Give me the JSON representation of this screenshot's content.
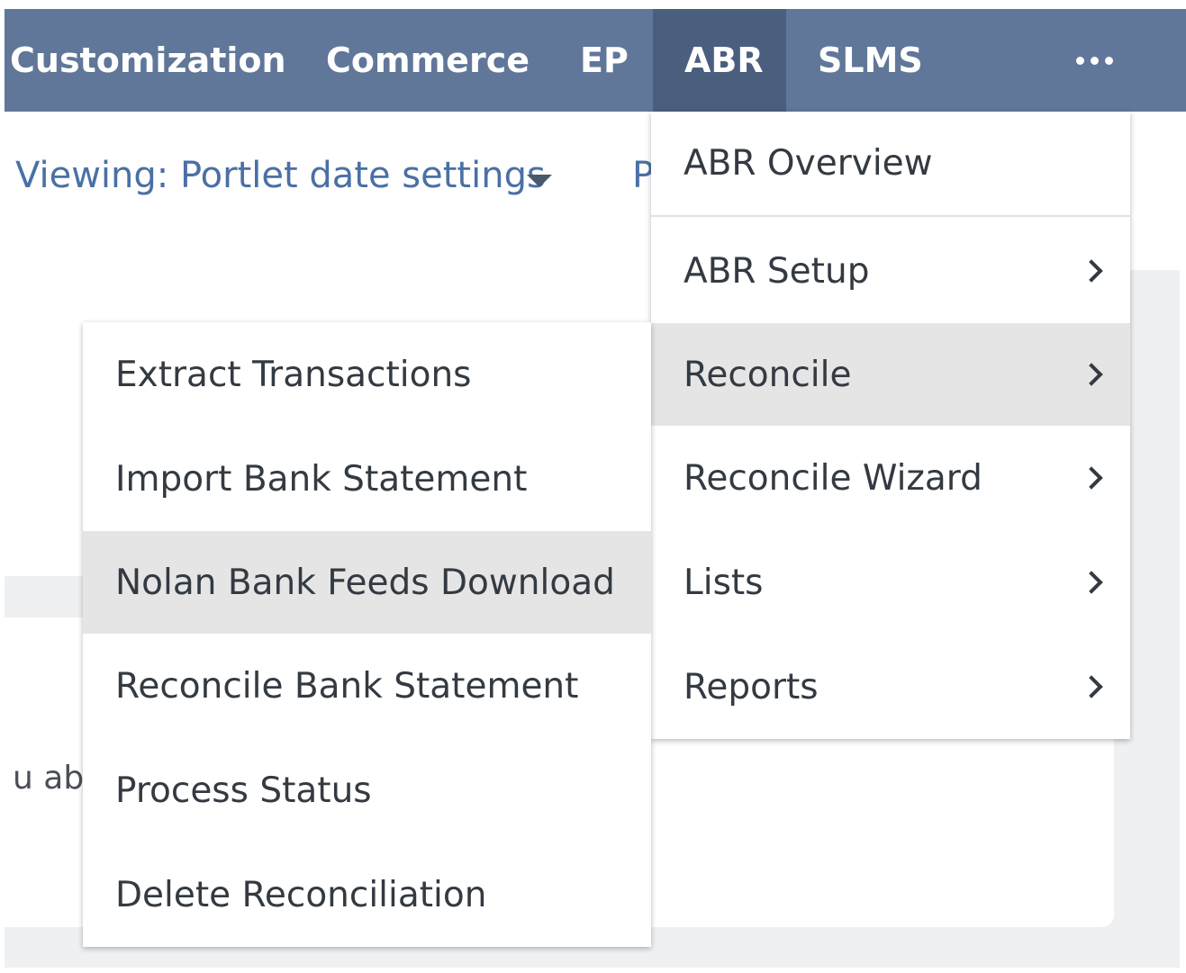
{
  "topnav": {
    "items": [
      {
        "label": "Customization"
      },
      {
        "label": "Commerce"
      },
      {
        "label": "EP"
      },
      {
        "label": "ABR"
      },
      {
        "label": "SLMS"
      }
    ],
    "more_icon": "ellipsis-icon"
  },
  "viewing": {
    "label": "Viewing: Portlet date settings",
    "next_partial": "P"
  },
  "background": {
    "partial_text": "u abo"
  },
  "abr_menu": {
    "items": [
      {
        "label": "ABR Overview",
        "has_submenu": false
      },
      {
        "label": "ABR Setup",
        "has_submenu": true
      },
      {
        "label": "Reconcile",
        "has_submenu": true
      },
      {
        "label": "Reconcile Wizard",
        "has_submenu": true
      },
      {
        "label": "Lists",
        "has_submenu": true
      },
      {
        "label": "Reports",
        "has_submenu": true
      }
    ]
  },
  "reconcile_submenu": {
    "items": [
      {
        "label": "Extract Transactions"
      },
      {
        "label": "Import Bank Statement"
      },
      {
        "label": "Nolan Bank Feeds Download"
      },
      {
        "label": "Reconcile Bank Statement"
      },
      {
        "label": "Process Status"
      },
      {
        "label": "Delete Reconciliation"
      }
    ]
  },
  "colors": {
    "nav_bg": "#607799",
    "nav_active_bg": "#4a5f7e",
    "link_text": "#4a70a5",
    "hover_bg": "#e5e5e5"
  }
}
